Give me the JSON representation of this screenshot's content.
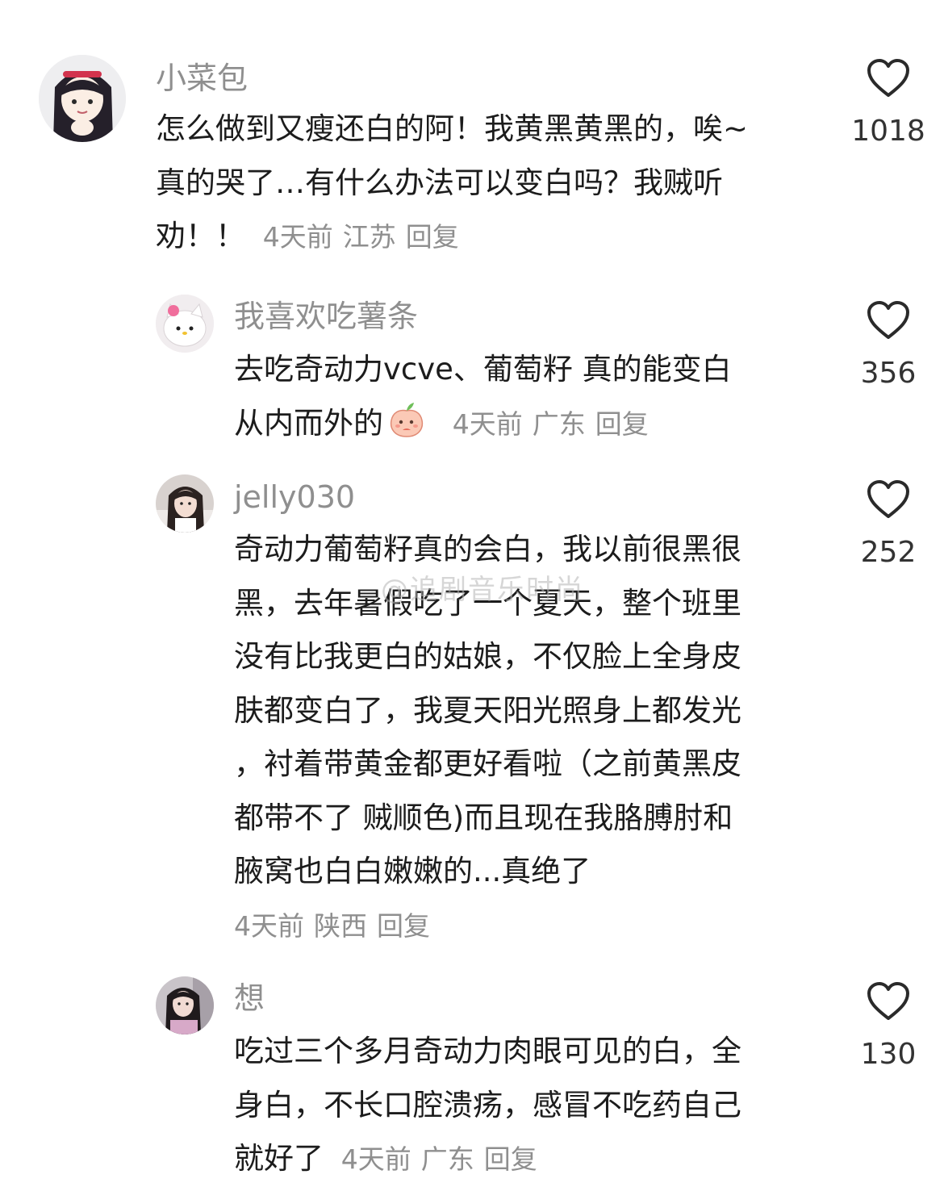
{
  "colors": {
    "meta_gray": "#8f8f8f",
    "text": "#1c1c1c",
    "heart_stroke": "#2a2a2a"
  },
  "watermark": "@追剧音乐时尚",
  "comments": [
    {
      "username": "小菜包",
      "lines": [
        "怎么做到又瘦还白的阿！我黄黑黄黑的，唉~",
        "真的哭了…有什么办法可以变白吗？我贼听"
      ],
      "last_line": "劝！！",
      "time": "4天前",
      "location": "江苏",
      "reply": "回复",
      "likes": "1018",
      "avatar_icon": "anime-girl-avatar",
      "like_icon": "heart-icon"
    },
    {
      "username": "我喜欢吃薯条",
      "lines": [
        "去吃奇动力vcve、葡萄籽 真的能变白"
      ],
      "last_line": "从内而外的",
      "emoji": "peach-emoji",
      "time": "4天前",
      "location": "广东",
      "reply": "回复",
      "likes": "356",
      "avatar_icon": "hello-kitty-avatar",
      "like_icon": "heart-icon"
    },
    {
      "username": "jelly030",
      "lines": [
        "奇动力葡萄籽真的会白，我以前很黑很",
        "黑，去年暑假吃了一个夏天，整个班里",
        "没有比我更白的姑娘，不仅脸上全身皮",
        "肤都变白了，我夏天阳光照身上都发光",
        "，衬着带黄金都更好看啦（之前黄黑皮",
        "都带不了 贼顺色)而且现在我胳膊肘和",
        "腋窝也白白嫩嫩的...真绝了"
      ],
      "time": "4天前",
      "location": "陕西",
      "reply": "回复",
      "likes": "252",
      "avatar_icon": "girl-photo-avatar",
      "like_icon": "heart-icon"
    },
    {
      "username": "想",
      "lines": [
        "吃过三个多月奇动力肉眼可见的白，全",
        "身白，不长口腔溃疡，感冒不吃药自己"
      ],
      "last_line": "就好了",
      "time": "4天前",
      "location": "广东",
      "reply": "回复",
      "likes": "130",
      "avatar_icon": "girl-photo-avatar",
      "like_icon": "heart-icon"
    }
  ]
}
